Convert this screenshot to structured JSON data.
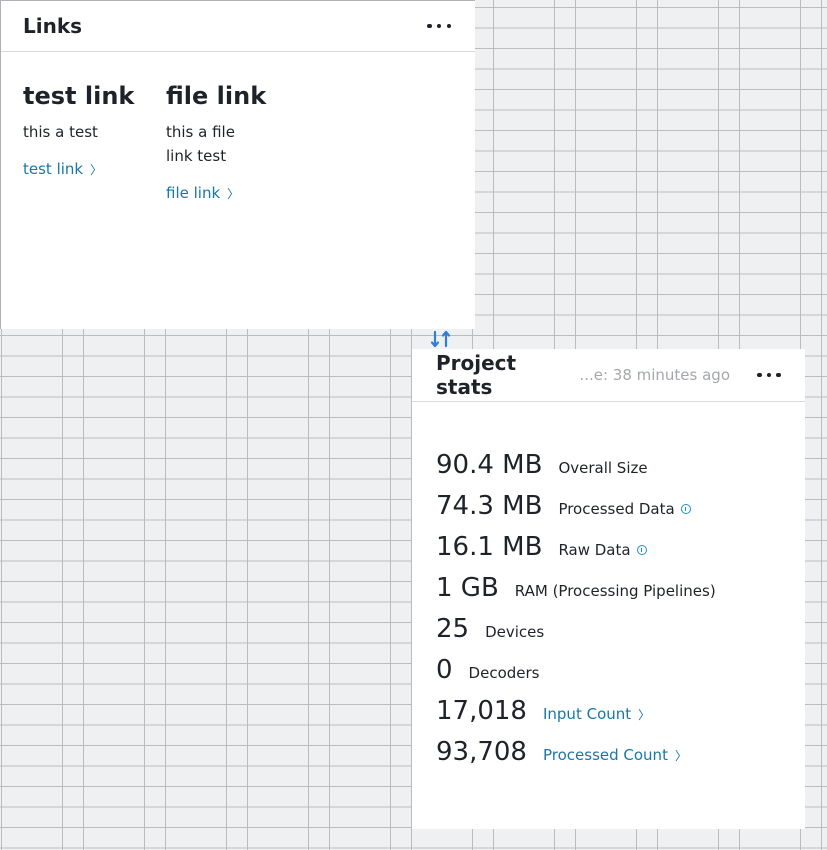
{
  "links_widget": {
    "title": "Links",
    "items": [
      {
        "title": "test link",
        "description": "this a test",
        "link_label": "test link",
        "chevron": "〉"
      },
      {
        "title": "file link",
        "description": "this a file link test",
        "link_label": "file link",
        "chevron": "〉"
      }
    ]
  },
  "stats_widget": {
    "title": "Project stats",
    "updated": "...e: 38 minutes ago",
    "rows": [
      {
        "value": "90.4 MB",
        "label": "Overall Size"
      },
      {
        "value": "74.3 MB",
        "label": "Processed Data",
        "info": true
      },
      {
        "value": "16.1 MB",
        "label": "Raw Data",
        "info": true
      },
      {
        "value": "1 GB",
        "label": "RAM (Processing Pipelines)"
      },
      {
        "value": "25",
        "label": "Devices"
      },
      {
        "value": "0",
        "label": "Decoders"
      },
      {
        "value": "17,018",
        "label": "Input Count",
        "link": true,
        "chevron": "〉"
      },
      {
        "value": "93,708",
        "label": "Processed Count",
        "link": true,
        "chevron": "〉"
      }
    ]
  },
  "colors": {
    "accent": "#1877a8",
    "info_icon": "#1e8fd0",
    "text": "#1f2329",
    "muted": "#a4a7ab"
  },
  "icons": {
    "more": "more-horizontal-icon",
    "swap": "swap-arrows-icon",
    "info": "info-icon"
  }
}
